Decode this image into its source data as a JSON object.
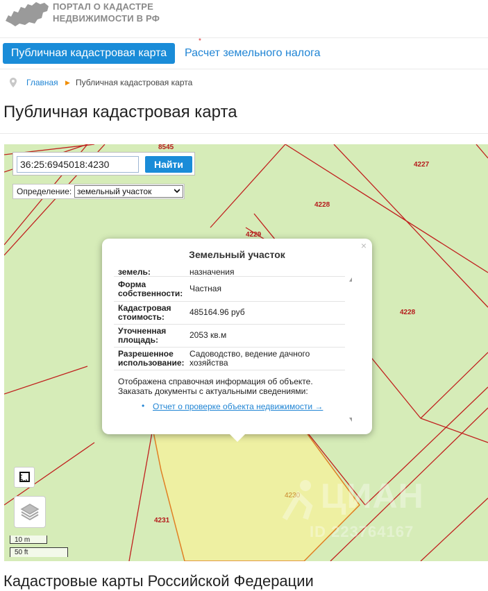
{
  "header": {
    "logo_line1": "ПОРТАЛ О КАДАСТРЕ",
    "logo_line2": "НЕДВИЖИМОСТИ В РФ"
  },
  "tabs": {
    "active_label": "Публичная кадастровая карта",
    "other_label": "Расчет земельного налога",
    "star": "*"
  },
  "breadcrumb": {
    "home": "Главная",
    "current": "Публичная кадастровая карта"
  },
  "page_title": "Публичная кадастровая карта",
  "map": {
    "search_value": "36:25:6945018:4230",
    "search_button": "Найти",
    "definition_label": "Определение:",
    "definition_value": "земельный участок",
    "parcel_labels": {
      "p8545": "8545",
      "p4227": "4227",
      "p4228a": "4228",
      "p4228b": "4228",
      "p4229": "4229",
      "p4230": "4230",
      "p4231": "4231"
    },
    "scale_metric": "10 m",
    "scale_imperial": "50 ft",
    "watermark": "ЦИАН",
    "watermark_id": "ID 223764167"
  },
  "popup": {
    "title": "Земельный участок",
    "close": "×",
    "partial_key": "земель:",
    "partial_value": "назначения",
    "rows": [
      {
        "key": "Форма собственности:",
        "value": "Частная"
      },
      {
        "key": "Кадастровая стоимость:",
        "value": "485164.96 руб"
      },
      {
        "key": "Уточненная площадь:",
        "value": "2053 кв.м"
      },
      {
        "key": "Разрешенное использование:",
        "value": "Садоводство, ведение дачного хозяйства"
      }
    ],
    "info": "Отображена справочная информация об объекте. Заказать документы с актуальными сведениями:",
    "link": "Отчет о проверке объекта недвижимости →"
  },
  "bottom_title": "Кадастровые карты Российской Федерации",
  "colors": {
    "accent": "#1a8cd8",
    "map_bg": "#d6ecb8",
    "parcel_line": "#c0201e",
    "selected_parcel": "#eef0a2"
  }
}
